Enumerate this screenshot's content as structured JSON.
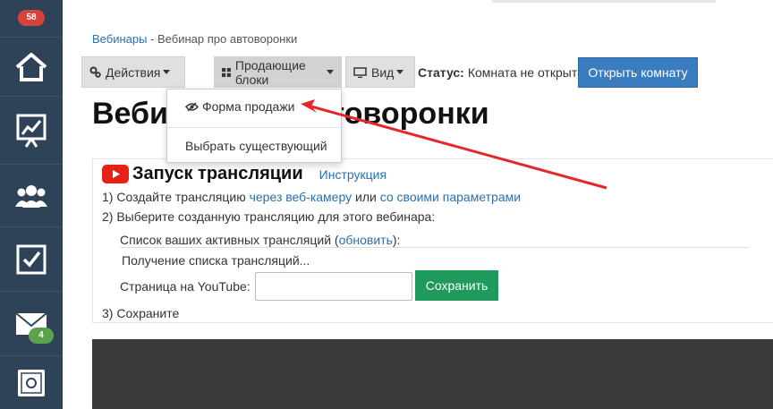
{
  "sidebar": {
    "notifications_count": "58",
    "mail_count": "4",
    "items": [
      {
        "icon": "home-icon"
      },
      {
        "icon": "analytics-icon"
      },
      {
        "icon": "users-icon"
      },
      {
        "icon": "tasks-checkbox-icon"
      },
      {
        "icon": "mail-icon"
      },
      {
        "icon": "safe-icon"
      }
    ],
    "colors": {
      "background": "#2f4358",
      "badge_red": "#d9423a",
      "badge_green": "#5aa34a"
    }
  },
  "breadcrumb": {
    "parent": "Вебинары",
    "separator": " - ",
    "current": "Вебинар про автоворонки"
  },
  "toolbar": {
    "actions_label": "Действия",
    "blocks_label": "Продающие блоки",
    "view_label": "Вид",
    "status_label": "Статус:",
    "status_value": "Комната не открыта",
    "open_room_label": "Открыть комнату"
  },
  "page_title": "Вебинар про автоворонки",
  "dropdown": {
    "items": [
      {
        "label": "Форма продажи",
        "icon": "eye-slash-icon"
      },
      {
        "label": "Выбрать существующий"
      }
    ]
  },
  "broadcast": {
    "title": "Запуск трансляции",
    "instruction_link": "Инструкция",
    "step1_prefix": "1) Создайте трансляцию ",
    "step1_link1": "через веб-камеру",
    "step1_mid": " или ",
    "step1_link2": "со своими параметрами",
    "step2": "2) Выберите созданную трансляцию для этого вебинара:",
    "list_label_prefix": "Список ваших активных трансляций (",
    "refresh_link": "обновить",
    "list_label_suffix": "):",
    "loading_text": "Получение списка трансляций...",
    "youtube_page_label": "Страница на YouTube:",
    "youtube_input_value": "",
    "save_label": "Сохранить",
    "step3": "3) Сохраните"
  },
  "annotation_color": "#e8262a"
}
